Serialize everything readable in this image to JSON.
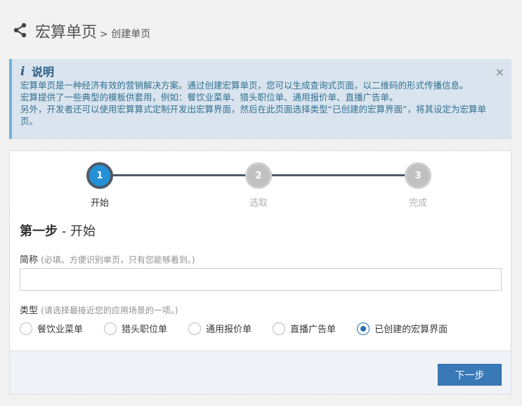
{
  "header": {
    "title": "宏算单页",
    "subtitle": "> 创建单页"
  },
  "alert": {
    "heading": "说明",
    "lines": [
      "宏算单页是一种经济有效的营销解决方案。通过创建宏算单页，您可以生成查询式页面，以二维码的形式传播信息。",
      "宏算提供了一些典型的模板供套用，例如：餐饮业菜单、猎头职位单、通用报价单、直播广告单。",
      "另外，开发者还可以使用宏算算式定制开发出宏算界面，然后在此页面选择类型“已创建的宏算界面”，将其设定为宏算单页。"
    ],
    "close": "×"
  },
  "steps": [
    {
      "number": "1",
      "label": "开始",
      "active": true
    },
    {
      "number": "2",
      "label": "选取",
      "active": false
    },
    {
      "number": "3",
      "label": "完成",
      "active": false
    }
  ],
  "section": {
    "title_bold": "第一步",
    "title_rest": " - 开始"
  },
  "form": {
    "name_label": "简称",
    "name_hint": "(必填。方便识别单页，只有您能够看到。)",
    "name_value": "",
    "type_label": "类型",
    "type_hint": "(请选择最接近您的应用场景的一项。)",
    "options": [
      {
        "label": "餐饮业菜单",
        "checked": false
      },
      {
        "label": "猎头职位单",
        "checked": false
      },
      {
        "label": "通用报价单",
        "checked": false
      },
      {
        "label": "直播广告单",
        "checked": false
      },
      {
        "label": "已创建的宏算界面",
        "checked": true
      }
    ]
  },
  "footer": {
    "next_label": "下一步"
  },
  "colors": {
    "accent": "#2490d8",
    "button": "#3a79b8",
    "alert_bg": "#d9e4ef"
  }
}
